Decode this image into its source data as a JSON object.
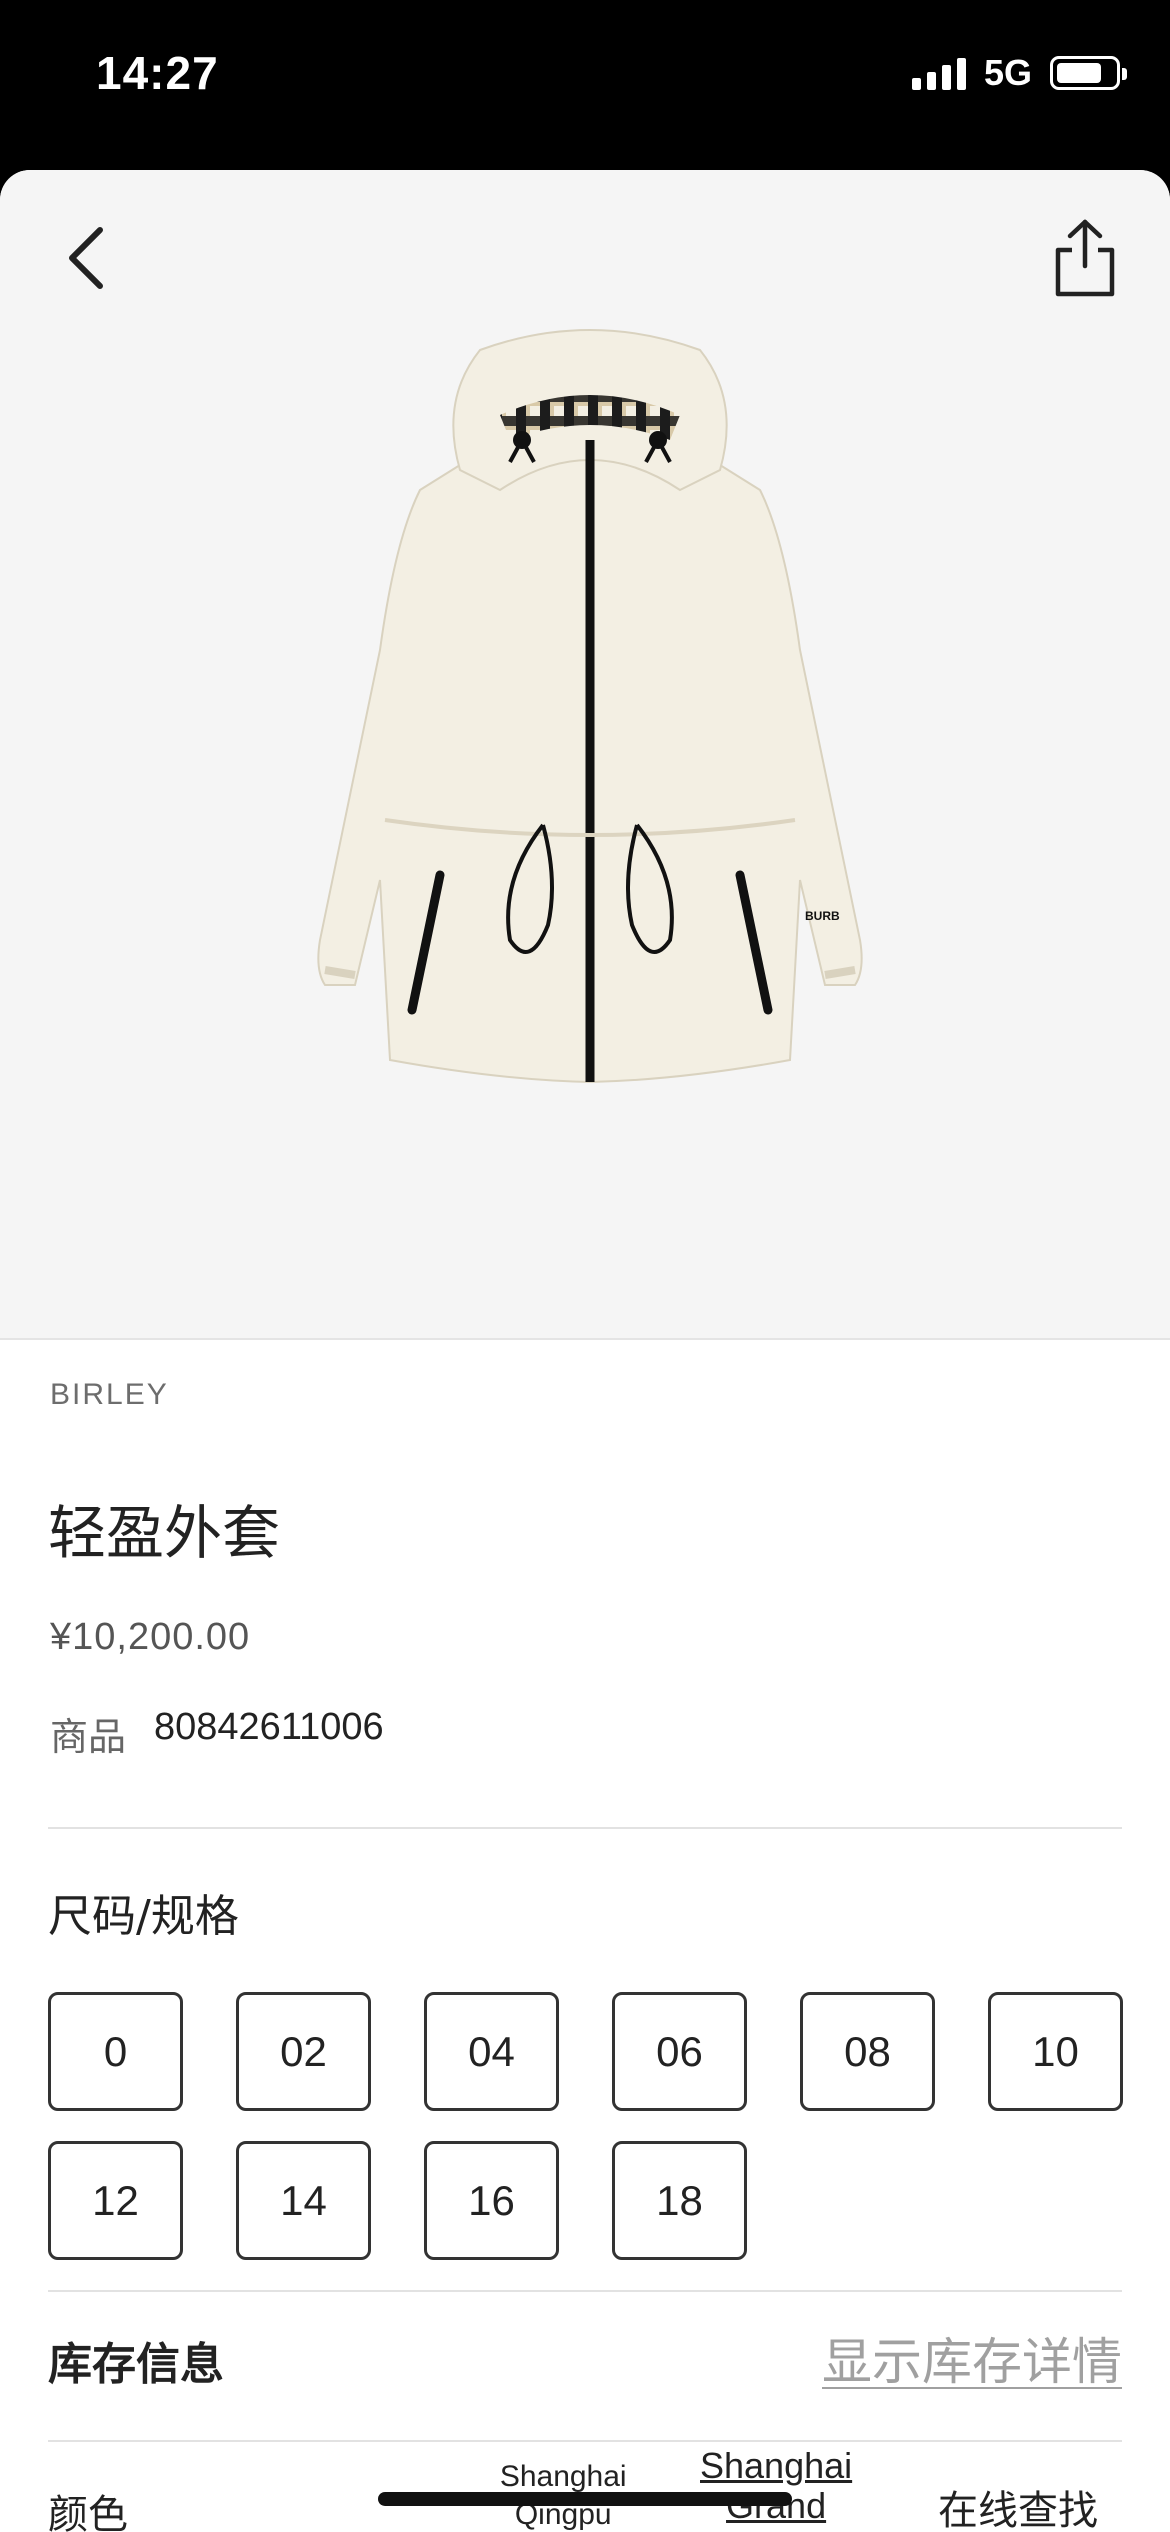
{
  "status_bar": {
    "time": "14:27",
    "network": "5G"
  },
  "toolbar": {
    "back_icon": "chevron-left-icon",
    "share_icon": "share-icon"
  },
  "product": {
    "brand": "BIRLEY",
    "title": "轻盈外套",
    "price": "¥10,200.00",
    "sku_label": "商品",
    "sku_value": "80842611006",
    "image_alt": "cream hooded jacket with black zipper"
  },
  "sizes": {
    "heading": "尺码/规格",
    "options": [
      "0",
      "02",
      "04",
      "06",
      "08",
      "10",
      "12",
      "14",
      "16",
      "18"
    ]
  },
  "stock": {
    "heading": "库存信息",
    "link": "显示库存详情"
  },
  "bottom_row": {
    "color_label": "颜色",
    "store_1": "Shanghai\nQingpu\nBeijing Outlet",
    "store_2": "Shanghai\nGrand",
    "online_find": "在线查找"
  },
  "colors": {
    "background": "#ffffff",
    "hero_bg": "#f5f5f5",
    "status_bar_bg": "#000000",
    "jacket": "#f3efe3"
  }
}
